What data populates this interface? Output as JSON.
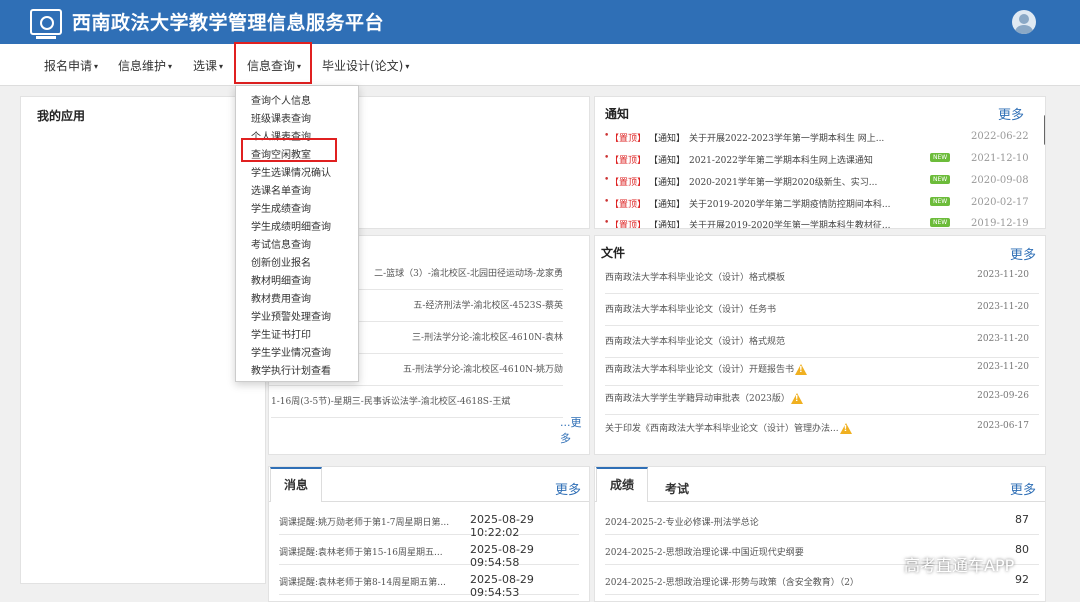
{
  "header": {
    "title": "西南政法大学教学管理信息服务平台"
  },
  "nav": {
    "items": [
      "报名申请",
      "信息维护",
      "选课",
      "信息查询",
      "毕业设计(论文)"
    ],
    "caret": "▾"
  },
  "dropdown": {
    "items": [
      "查询个人信息",
      "班级课表查询",
      "个人课表查询",
      "查询空闲教室",
      "学生选课情况确认",
      "选课名单查询",
      "学生成绩查询",
      "学生成绩明细查询",
      "考试信息查询",
      "创新创业报名",
      "教材明细查询",
      "教材费用查询",
      "学业预警处理查询",
      "学生证书打印",
      "学生学业情况查询",
      "教学执行计划查看"
    ]
  },
  "my_apps": {
    "title": "我的应用"
  },
  "notice": {
    "title": "通知",
    "more": "更多",
    "rows": [
      {
        "top": "【置顶】",
        "tag": "【通知】",
        "text": "关于开展2022-2023学年第一学期本科生 网上...",
        "new": "",
        "date": "2022-06-22"
      },
      {
        "top": "【置顶】",
        "tag": "【通知】",
        "text": "2021-2022学年第二学期本科生网上选课通知",
        "new": "NEW",
        "date": "2021-12-10"
      },
      {
        "top": "【置顶】",
        "tag": "【通知】",
        "text": "2020-2021学年第一学期2020级新生、实习...",
        "new": "NEW",
        "date": "2020-09-08"
      },
      {
        "top": "【置顶】",
        "tag": "【通知】",
        "text": "关于2019-2020学年第二学期疫情防控期间本科...",
        "new": "NEW",
        "date": "2020-02-17"
      },
      {
        "top": "【置顶】",
        "tag": "【通知】",
        "text": "关于开展2019-2020学年第一学期本科生教材征...",
        "new": "NEW",
        "date": "2019-12-19"
      }
    ]
  },
  "schedule": {
    "rows": [
      "二-篮球（3）-渝北校区-北园田径运动场-龙家勇",
      "五-经济刑法学-渝北校区-4523S-蔡英",
      "三-刑法学分论-渝北校区-4610N-袁林",
      "五-刑法学分论-渝北校区-4610N-姚万勋",
      "1-16周(3-5节)-星期三-民事诉讼法学-渝北校区-4618S-王斌"
    ],
    "more": "...更多"
  },
  "files": {
    "title": "文件",
    "more": "更多",
    "rows": [
      {
        "text": "西南政法大学本科毕业论文（设计）格式模板",
        "warn": false,
        "date": "2023-11-20"
      },
      {
        "text": "西南政法大学本科毕业论文（设计）任务书",
        "warn": false,
        "date": "2023-11-20"
      },
      {
        "text": "西南政法大学本科毕业论文（设计）格式规范",
        "warn": false,
        "date": "2023-11-20"
      },
      {
        "text": "西南政法大学本科毕业论文（设计）开题报告书",
        "warn": true,
        "date": "2023-11-20"
      },
      {
        "text": "西南政法大学学生学籍异动审批表（2023版）",
        "warn": true,
        "date": "2023-09-26"
      },
      {
        "text": "关于印发《西南政法大学本科毕业论文（设计）管理办法...",
        "warn": true,
        "date": "2023-06-17"
      }
    ]
  },
  "messages": {
    "tab": "消息",
    "more": "更多",
    "rows": [
      {
        "text": "调课提醒:姚万勋老师于第1-7周星期日第...",
        "time": "2025-08-29 10:22:02"
      },
      {
        "text": "调课提醒:袁林老师于第15-16周星期五...",
        "time": "2025-08-29 09:54:58"
      },
      {
        "text": "调课提醒:袁林老师于第8-14周星期五第...",
        "time": "2025-08-29 09:54:53"
      }
    ]
  },
  "grades": {
    "tab_grades": "成绩",
    "tab_exams": "考试",
    "more": "更多",
    "rows": [
      {
        "text": "2024-2025-2-专业必修课-刑法学总论",
        "score": "87"
      },
      {
        "text": "2024-2025-2-思想政治理论课-中国近现代史纲要",
        "score": "80"
      },
      {
        "text": "2024-2025-2-思想政治理论课-形势与政策（含安全教育）（2）",
        "score": "92"
      }
    ]
  },
  "watermark": "高考直通车APP",
  "colors": {
    "primary": "#2f6fb6",
    "highlight": "#e02020",
    "new_badge": "#6cbc3a"
  }
}
